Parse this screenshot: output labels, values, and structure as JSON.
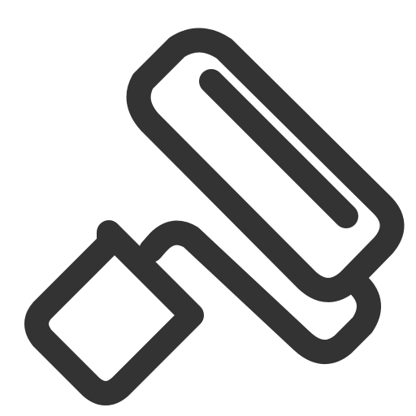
{
  "icon": {
    "semantic_name": "paint-roller-icon",
    "stroke_color": "#333333",
    "background_color": "#ffffff"
  }
}
